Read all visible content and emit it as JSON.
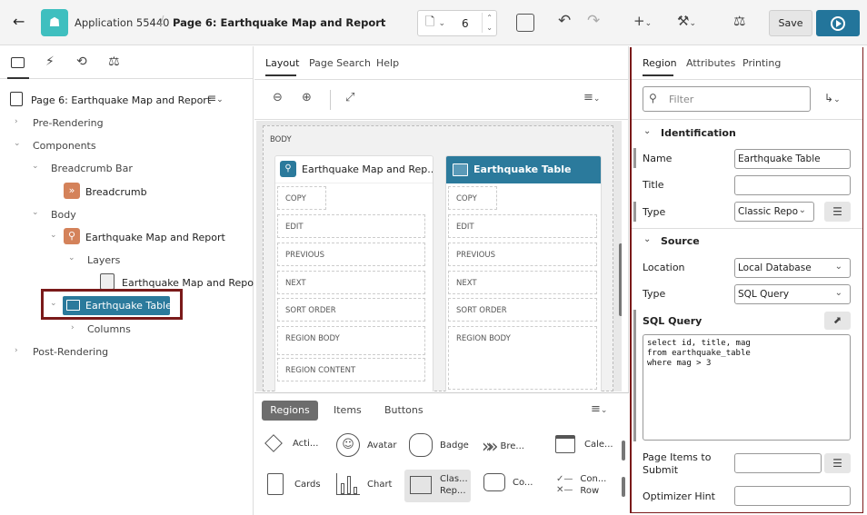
{
  "header": {
    "back": "←",
    "app_name": "Application 55440",
    "page_title": "Page 6: Earthquake Map and Report",
    "page_number": "6",
    "save_label": "Save"
  },
  "left_tree": {
    "root": "Page 6: Earthquake Map and Report",
    "items": {
      "pre_rendering": "Pre-Rendering",
      "components": "Components",
      "breadcrumb_bar": "Breadcrumb Bar",
      "breadcrumb": "Breadcrumb",
      "body": "Body",
      "eq_map": "Earthquake Map and Report",
      "layers": "Layers",
      "eq_map_layer": "Earthquake Map and Report",
      "eq_table": "Earthquake Table",
      "columns": "Columns",
      "post_rendering": "Post-Rendering"
    }
  },
  "center": {
    "tabs": [
      "Layout",
      "Page Search",
      "Help"
    ],
    "body_label": "BODY",
    "region_map": {
      "title": "Earthquake Map and Rep...",
      "slots": [
        "COPY",
        "EDIT",
        "PREVIOUS",
        "NEXT",
        "SORT ORDER",
        "REGION BODY",
        "REGION CONTENT"
      ]
    },
    "region_table": {
      "title": "Earthquake Table",
      "slots": [
        "COPY",
        "EDIT",
        "PREVIOUS",
        "NEXT",
        "SORT ORDER",
        "REGION BODY"
      ]
    },
    "gallery_tabs": [
      "Regions",
      "Items",
      "Buttons"
    ],
    "gallery": [
      {
        "label": "Acti..."
      },
      {
        "label": "Avatar"
      },
      {
        "label": "Badge"
      },
      {
        "label": "Bre..."
      },
      {
        "label": "Cale..."
      },
      {
        "label": "Cards"
      },
      {
        "label": "Chart"
      },
      {
        "label": "Clas... Rep..."
      },
      {
        "label": "Co..."
      },
      {
        "label": "Con... Row"
      }
    ]
  },
  "right": {
    "tabs": [
      "Region",
      "Attributes",
      "Printing"
    ],
    "filter_placeholder": "Filter",
    "identification": {
      "section": "Identification",
      "name_label": "Name",
      "name_value": "Earthquake Table",
      "title_label": "Title",
      "title_value": "",
      "type_label": "Type",
      "type_value": "Classic Repo"
    },
    "source": {
      "section": "Source",
      "location_label": "Location",
      "location_value": "Local Database",
      "type_label": "Type",
      "type_value": "SQL Query",
      "sql_label": "SQL Query",
      "sql_line1": "select id, title, mag",
      "sql_line2": "from earthquake_table",
      "sql_line3": "where mag > 3",
      "page_items_label1": "Page Items to",
      "page_items_label2": "Submit",
      "optimizer_label": "Optimizer Hint"
    }
  }
}
